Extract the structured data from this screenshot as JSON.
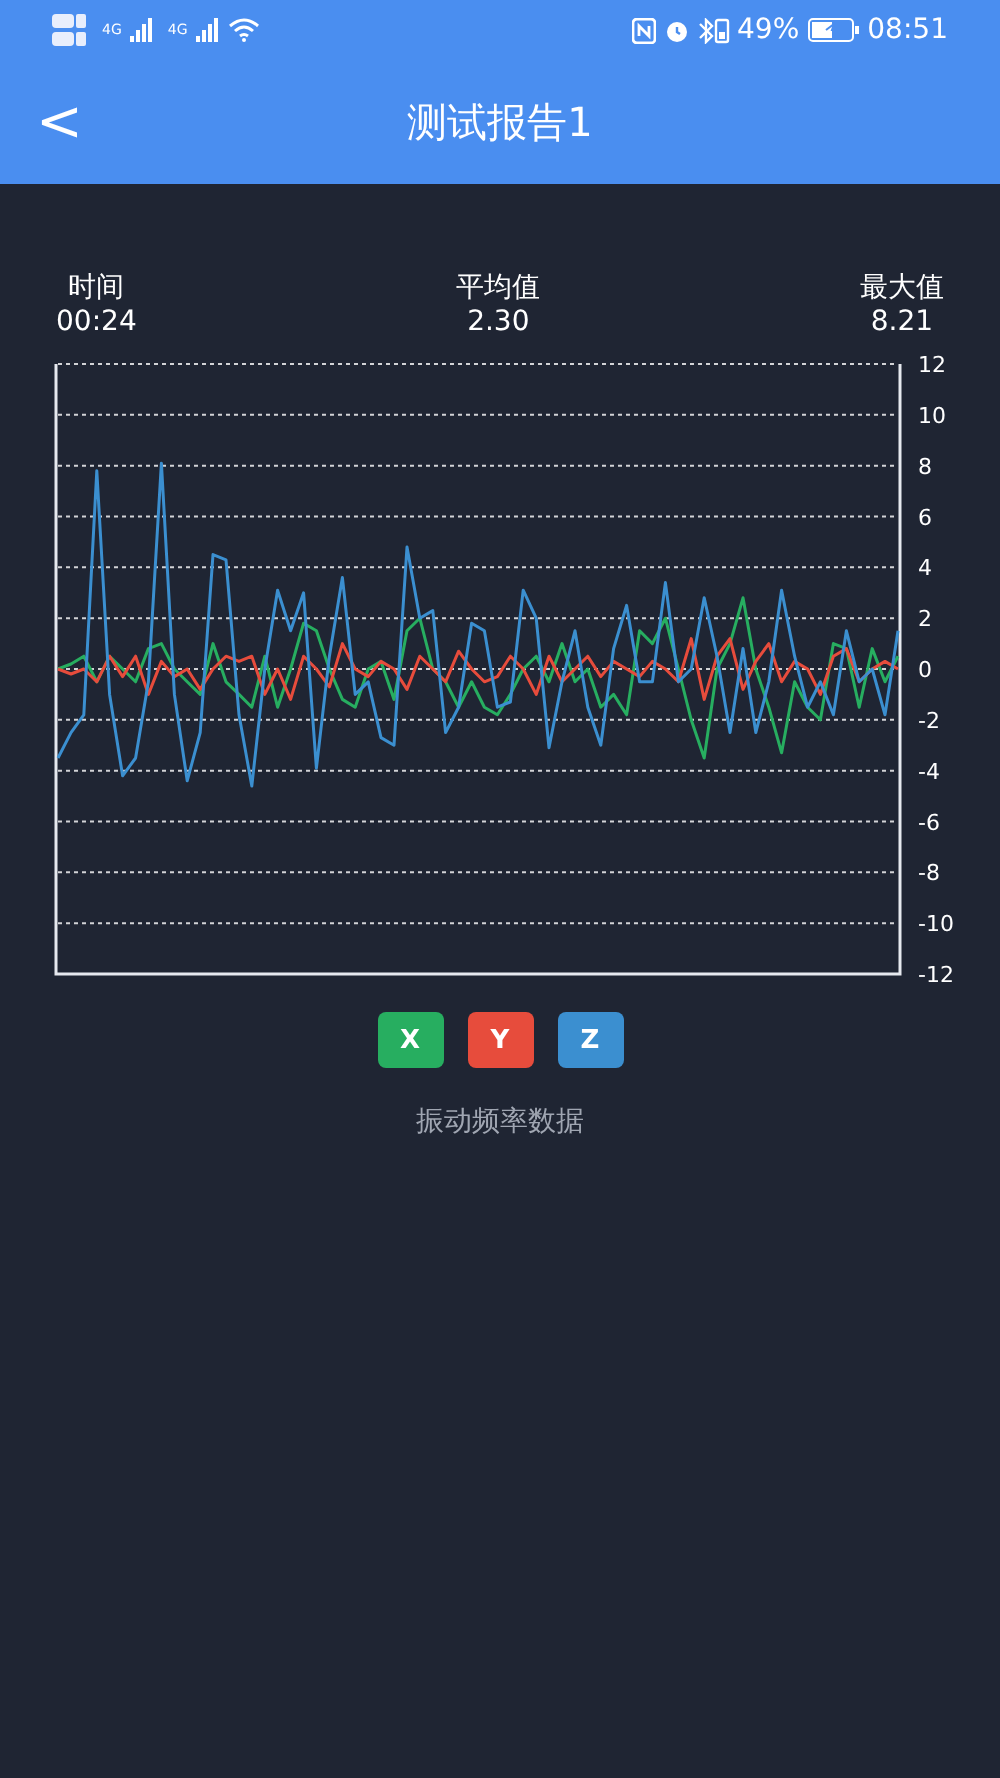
{
  "status_bar": {
    "network": [
      "4G",
      "4G"
    ],
    "battery": "49%",
    "time": "08:51"
  },
  "header": {
    "back": "<",
    "title": "测试报告1"
  },
  "stats": [
    {
      "label": "时间",
      "value": "00:24"
    },
    {
      "label": "平均值",
      "value": "2.30"
    },
    {
      "label": "最大值",
      "value": "8.21"
    }
  ],
  "chart": {
    "chart_data": {
      "type": "line",
      "grid": true,
      "ylim": [
        -12,
        12
      ],
      "yticks": [
        12,
        10,
        8,
        6,
        4,
        2,
        0,
        -2,
        -4,
        -6,
        -8,
        -10,
        -12
      ],
      "series": [
        {
          "name": "X",
          "color": "#27ae60",
          "values": [
            0,
            0.2,
            0.5,
            -0.5,
            0.5,
            0,
            -0.5,
            0.8,
            1,
            0,
            -0.5,
            -1,
            1,
            -0.5,
            -1,
            -1.5,
            0.5,
            -1.5,
            0,
            1.8,
            1.5,
            0,
            -1.2,
            -1.5,
            0,
            0.3,
            -1.2,
            1.5,
            2,
            0,
            -0.5,
            -1.5,
            -0.5,
            -1.5,
            -1.8,
            -1,
            0,
            0.5,
            -0.5,
            1,
            -0.5,
            0,
            -1.5,
            -1,
            -1.8,
            1.5,
            1,
            2,
            0,
            -2,
            -3.5,
            0,
            1,
            2.8,
            0,
            -1.5,
            -3.3,
            -0.5,
            -1.5,
            -2,
            1,
            0.8,
            -1.5,
            0.8,
            -0.5,
            0.5
          ]
        },
        {
          "name": "Y",
          "color": "#e74c3c",
          "values": [
            0,
            -0.2,
            0,
            -0.5,
            0.5,
            -0.3,
            0.5,
            -1,
            0.3,
            -0.3,
            0,
            -0.8,
            0,
            0.5,
            0.3,
            0.5,
            -1,
            0,
            -1.2,
            0.5,
            0,
            -0.7,
            1,
            0,
            -0.3,
            0.3,
            0,
            -0.8,
            0.5,
            0,
            -0.5,
            0.7,
            0,
            -0.5,
            -0.3,
            0.5,
            0,
            -1,
            0.5,
            -0.5,
            0,
            0.5,
            -0.3,
            0.3,
            0,
            -0.3,
            0.3,
            0,
            -0.5,
            1.2,
            -1.2,
            0.5,
            1.2,
            -0.8,
            0.3,
            1,
            -0.5,
            0.3,
            0,
            -1,
            0.5,
            0.8,
            -0.5,
            0,
            0.3,
            0
          ]
        },
        {
          "name": "Z",
          "color": "#3b8fd0",
          "values": [
            -3.5,
            -2.5,
            -1.8,
            7.8,
            -1,
            -4.2,
            -3.5,
            -0.5,
            8.1,
            -1,
            -4.4,
            -2.5,
            4.5,
            4.3,
            -1.8,
            -4.6,
            0,
            3.1,
            1.5,
            3,
            -3.9,
            0.5,
            3.6,
            -1,
            -0.5,
            -2.7,
            -3,
            4.8,
            2,
            2.3,
            -2.5,
            -1.5,
            1.8,
            1.5,
            -1.5,
            -1.3,
            3.1,
            2,
            -3.1,
            -0.5,
            1.5,
            -1.5,
            -3,
            0.8,
            2.5,
            -0.5,
            -0.5,
            3.4,
            -0.5,
            0,
            2.8,
            0.5,
            -2.5,
            0.8,
            -2.5,
            -0.5,
            3.1,
            0.5,
            -1.5,
            -0.5,
            -1.8,
            1.5,
            -0.5,
            0,
            -1.8,
            1.5
          ]
        }
      ]
    }
  },
  "caption": "振动频率数据"
}
